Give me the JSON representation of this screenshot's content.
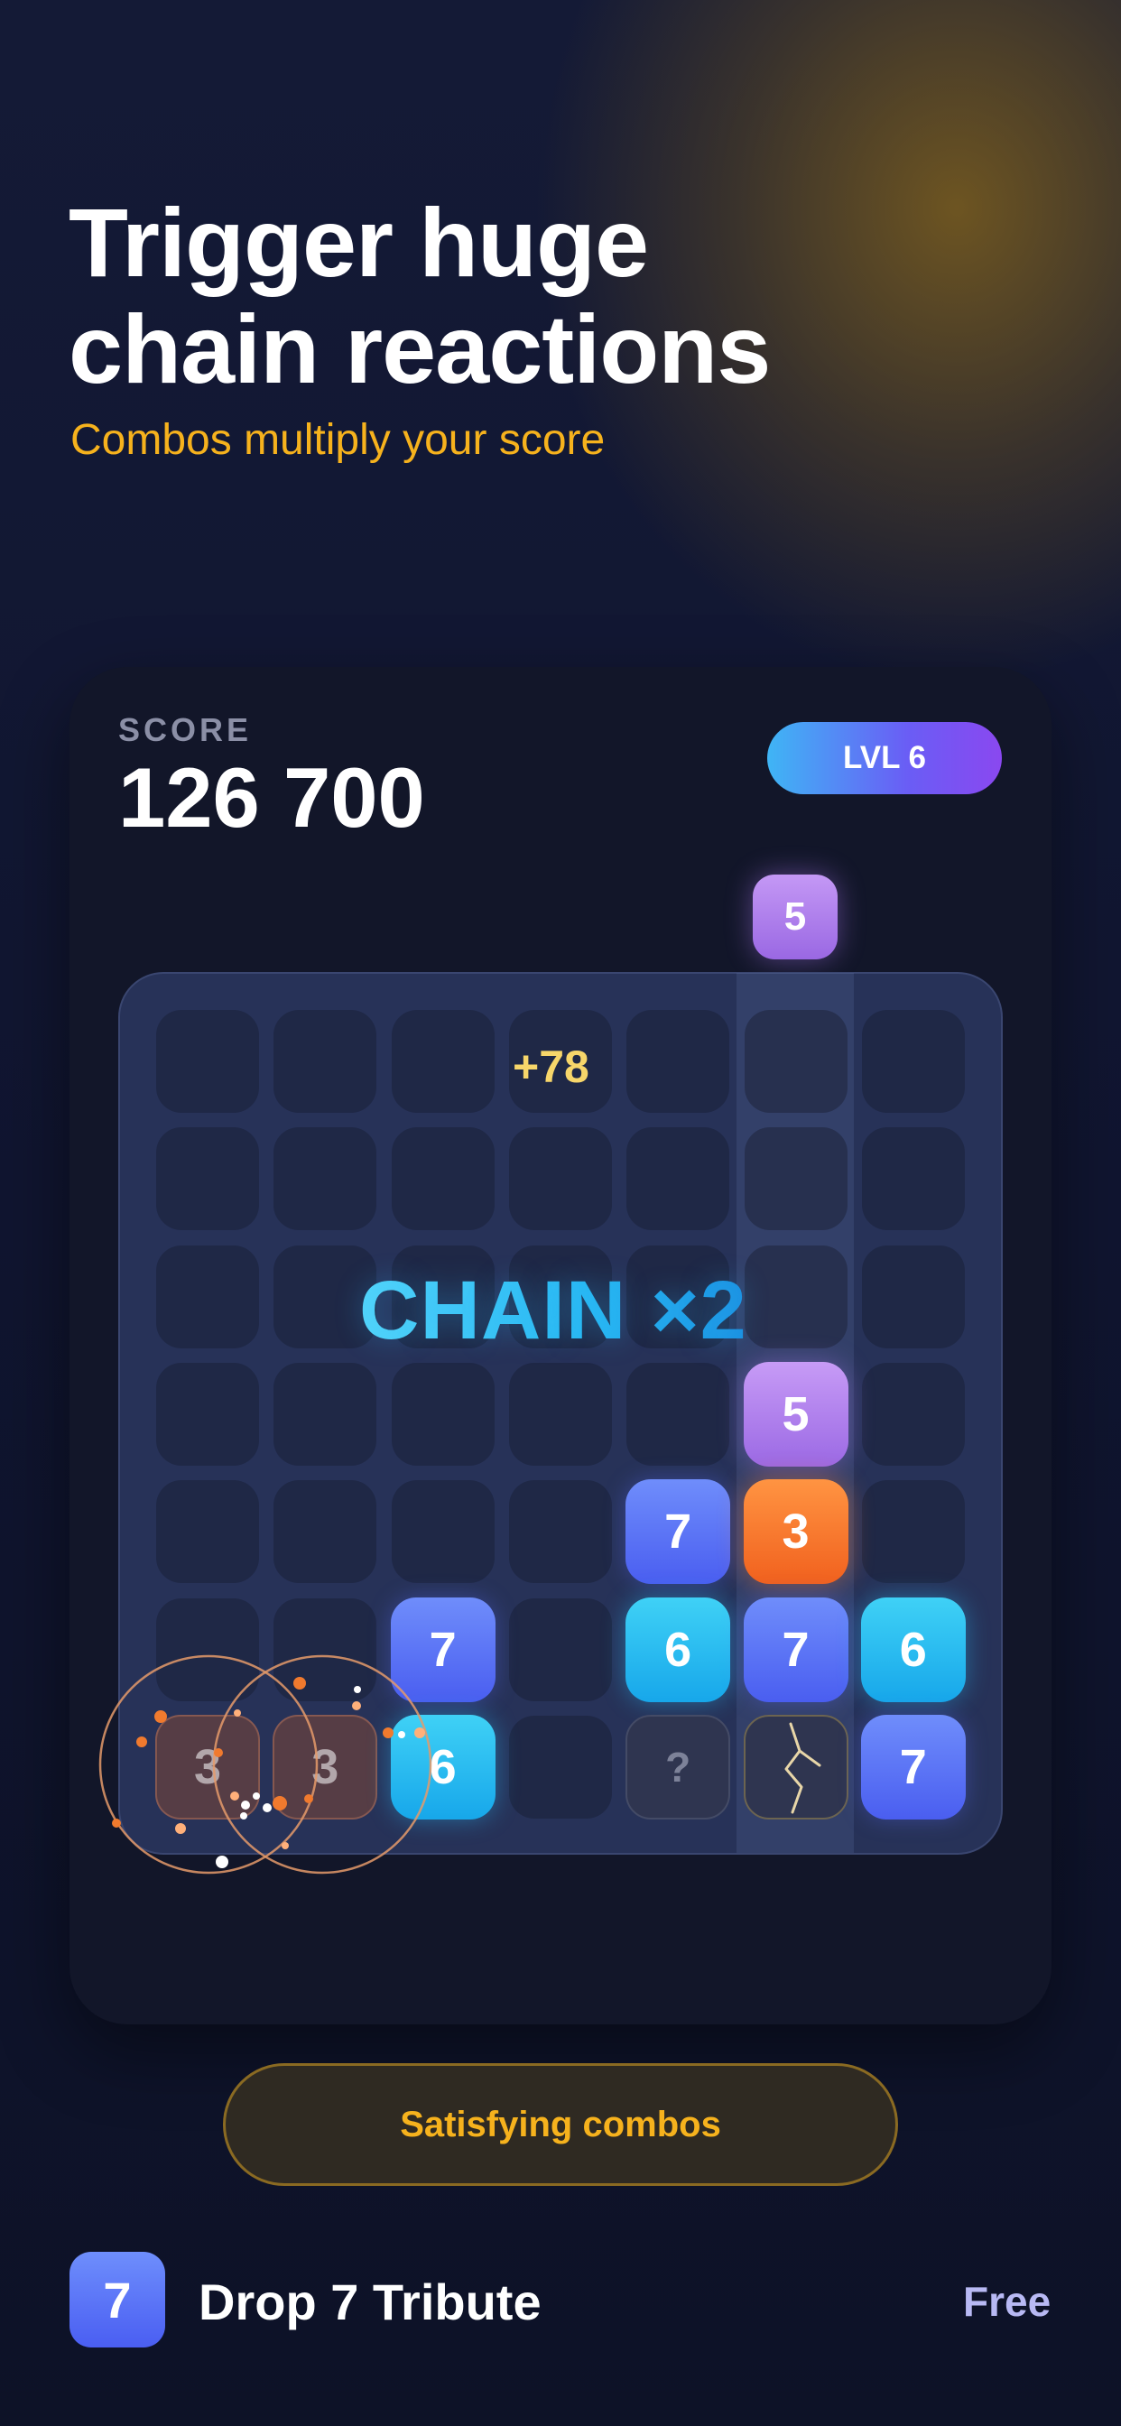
{
  "header": {
    "headline_line1": "Trigger huge",
    "headline_line2": "chain reactions",
    "subline": "Combos multiply your score"
  },
  "game": {
    "score_label": "SCORE",
    "score_value": "126 700",
    "level": "LVL 6",
    "next_drop": "5",
    "points_popup": "+78",
    "chain_text": "CHAIN ×2",
    "grid": {
      "rows": 7,
      "cols": 7
    },
    "tiles": [
      {
        "row": 4,
        "col": 6,
        "value": "5",
        "kind": "purple"
      },
      {
        "row": 5,
        "col": 5,
        "value": "7",
        "kind": "blue"
      },
      {
        "row": 5,
        "col": 6,
        "value": "3",
        "kind": "orange"
      },
      {
        "row": 6,
        "col": 3,
        "value": "7",
        "kind": "blue"
      },
      {
        "row": 6,
        "col": 5,
        "value": "6",
        "kind": "cyan"
      },
      {
        "row": 6,
        "col": 6,
        "value": "7",
        "kind": "blue"
      },
      {
        "row": 6,
        "col": 7,
        "value": "6",
        "kind": "cyan"
      },
      {
        "row": 7,
        "col": 1,
        "value": "3",
        "kind": "exploding"
      },
      {
        "row": 7,
        "col": 2,
        "value": "3",
        "kind": "exploding"
      },
      {
        "row": 7,
        "col": 3,
        "value": "6",
        "kind": "cyan"
      },
      {
        "row": 7,
        "col": 5,
        "value": "?",
        "kind": "hidden"
      },
      {
        "row": 7,
        "col": 6,
        "value": "",
        "kind": "cracked"
      },
      {
        "row": 7,
        "col": 7,
        "value": "7",
        "kind": "blue"
      }
    ],
    "highlighted_column": 6
  },
  "feature_pill": "Satisfying combos",
  "app": {
    "icon_glyph": "7",
    "name": "Drop 7 Tribute",
    "price": "Free"
  },
  "colors": {
    "accent_gold": "#f6b21d",
    "tile_purple": "#b283f0",
    "tile_orange": "#f57a2c",
    "tile_blue": "#5a72f6",
    "tile_cyan": "#2bbff2",
    "chain_cyan": "#3cc6f6",
    "popup_yellow": "#f7d66a",
    "price_lavender": "#b8b9f4"
  }
}
